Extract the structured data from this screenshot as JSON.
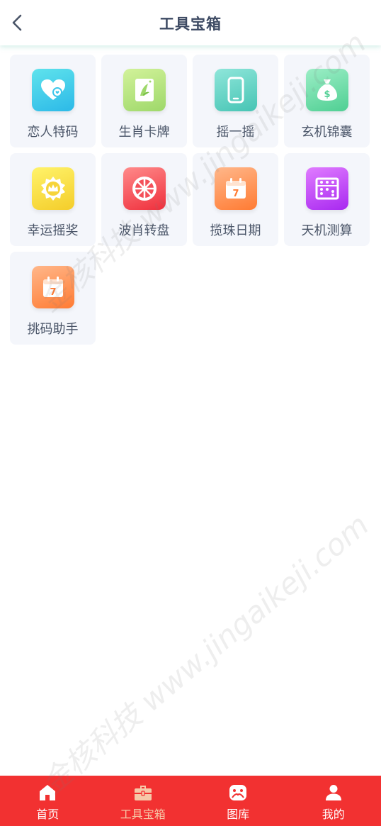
{
  "header": {
    "title": "工具宝箱",
    "back_icon": "chevron-left-icon"
  },
  "tools": [
    {
      "label": "恋人特码",
      "icon": "heart-icon",
      "color": "cyan"
    },
    {
      "label": "生肖卡牌",
      "icon": "card-icon",
      "color": "lime"
    },
    {
      "label": "摇一摇",
      "icon": "phone-icon",
      "color": "teal"
    },
    {
      "label": "玄机锦囊",
      "icon": "money-bag-icon",
      "color": "mint"
    },
    {
      "label": "幸运摇奖",
      "icon": "crown-badge-icon",
      "color": "yellow"
    },
    {
      "label": "波肖转盘",
      "icon": "wheel-icon",
      "color": "red"
    },
    {
      "label": "揽珠日期",
      "icon": "calendar-icon",
      "color": "orange"
    },
    {
      "label": "天机测算",
      "icon": "abacus-icon",
      "color": "purple"
    },
    {
      "label": "挑码助手",
      "icon": "calendar-icon",
      "color": "orange"
    }
  ],
  "tabbar": {
    "items": [
      {
        "label": "首页",
        "icon": "home-icon",
        "active": false
      },
      {
        "label": "工具宝箱",
        "icon": "toolbox-icon",
        "active": true
      },
      {
        "label": "图库",
        "icon": "gallery-icon",
        "active": false
      },
      {
        "label": "我的",
        "icon": "user-icon",
        "active": false
      }
    ]
  },
  "watermark": {
    "text_1": "金核科技 www.jingaikeji.com",
    "text_2": "金核科技 www.jingaikeji.com"
  },
  "colors": {
    "tabbar_bg": "#f23131",
    "active_tab_label": "#f6c8a8",
    "tile_bg": "#f4f6fb",
    "title_text": "#3d4a63"
  }
}
